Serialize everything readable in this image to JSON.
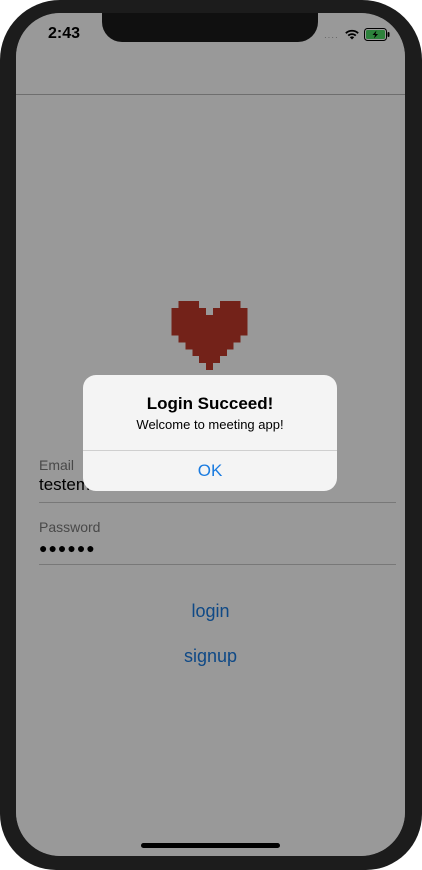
{
  "status_bar": {
    "time": "2:43",
    "signal": "····",
    "wifi_icon": "wifi-icon",
    "battery_icon": "battery-charging-icon",
    "battery_color": "#4cd964"
  },
  "logo": {
    "icon": "pixel-heart-icon",
    "color": "#c0392b"
  },
  "form": {
    "email_label": "Email",
    "email_value": "testem",
    "password_label": "Password",
    "password_value": "●●●●●●"
  },
  "buttons": {
    "login_label": "login",
    "signup_label": "signup"
  },
  "alert": {
    "title": "Login Succeed!",
    "message": "Welcome to meeting app!",
    "ok_label": "OK"
  },
  "colors": {
    "accent": "#1a7be0",
    "overlay": "rgba(0,0,0,0.40)"
  }
}
